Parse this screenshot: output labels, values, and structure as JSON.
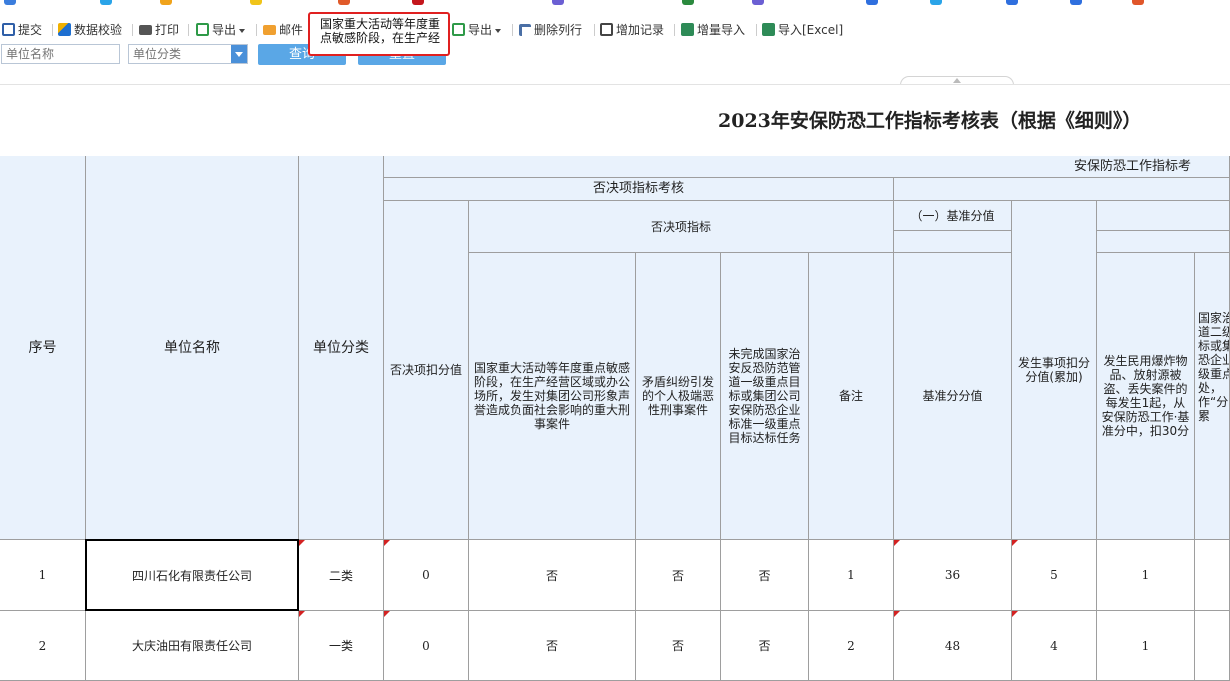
{
  "colors": {
    "accent": "#5aa7e6",
    "header_bg": "#e9f2fc",
    "highlight": "#e02020",
    "flag": "#d32222"
  },
  "toolbar": {
    "submit": "提交",
    "validate": "数据校验",
    "print": "打印",
    "export1": "导出",
    "mail": "邮件",
    "tooltip": "国家重大活动等年度重点敏感阶段，在生产经",
    "export2": "导出",
    "delete_col": "删除列行",
    "add_record": "增加记录",
    "incr_import": "增量导入",
    "import_excel": "导入[Excel]"
  },
  "filters": {
    "unit_name_placeholder": "单位名称",
    "unit_category_placeholder": "单位分类",
    "query": "查询",
    "reset": "重置"
  },
  "report": {
    "title": "2023年安保防恐工作指标考核表（根据《细则》）"
  },
  "table": {
    "header": {
      "seq": "序号",
      "unit_name": "单位名称",
      "unit_category": "单位分类",
      "group_main": "安保防恐工作指标考",
      "group_veto": "否决项指标考核",
      "veto_deduct": "否决项扣分值",
      "veto_indicators": "否决项指标",
      "veto_item1": "国家重大活动等年度重点敏感阶段，在生产经营区域或办公场所，发生对集团公司形象声誉造成负面社会影响的重大刑事案件",
      "veto_item2": "矛盾纠纷引发的个人极端恶性刑事案件",
      "veto_item3": "未完成国家治安反恐防范管道一级重点目标或集团公司安保防恐企业标准一级重点目标达标任务",
      "remark": "备注",
      "base_group": "（一）基准分值",
      "base_value": "基准分分值",
      "incident_accum": "发生事项扣分分值(累加)",
      "item_a": "发生民用爆炸物品、放射源被盗、丢失案件的每发生1起，从安保防恐工作·基准分中，扣30分",
      "item_b": "国家治道二级标或集恐企业级重点 处，作“分，累"
    },
    "rows": [
      {
        "seq": "1",
        "unit_name": "四川石化有限责任公司",
        "category": "二类",
        "veto_deduct": "0",
        "v1": "否",
        "v2": "否",
        "v3": "否",
        "remark": "1",
        "base": "36",
        "incident": "5",
        "a": "1"
      },
      {
        "seq": "2",
        "unit_name": "大庆油田有限责任公司",
        "category": "一类",
        "veto_deduct": "0",
        "v1": "否",
        "v2": "否",
        "v3": "否",
        "remark": "2",
        "base": "48",
        "incident": "4",
        "a": "1"
      }
    ]
  }
}
